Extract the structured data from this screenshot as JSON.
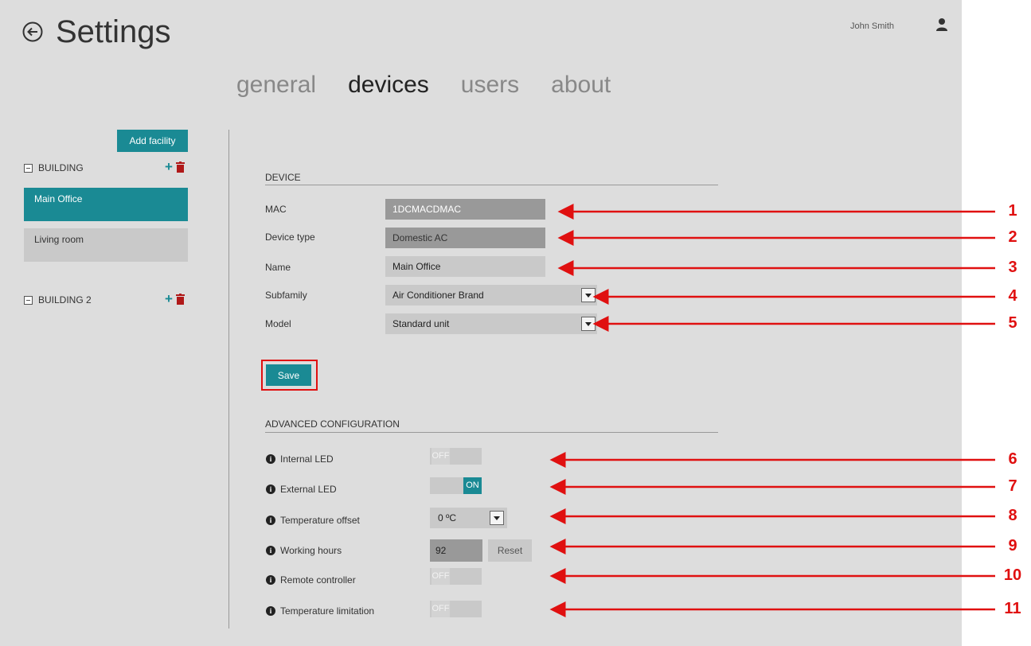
{
  "header": {
    "title": "Settings",
    "user_name": "John Smith"
  },
  "tabs": [
    {
      "label": "general",
      "active": false
    },
    {
      "label": "devices",
      "active": true
    },
    {
      "label": "users",
      "active": false
    },
    {
      "label": "about",
      "active": false
    }
  ],
  "sidebar": {
    "add_facility_label": "Add facility",
    "buildings": [
      {
        "name": "BUILDING",
        "rooms": [
          {
            "name": "Main Office",
            "selected": true
          },
          {
            "name": "Living room",
            "selected": false
          }
        ]
      },
      {
        "name": "BUILDING 2",
        "rooms": []
      }
    ]
  },
  "device": {
    "section_title": "DEVICE",
    "mac_label": "MAC",
    "mac_value": "1DCMACDMAC",
    "type_label": "Device type",
    "type_value": "Domestic AC",
    "name_label": "Name",
    "name_value": "Main Office",
    "subfamily_label": "Subfamily",
    "subfamily_value": "Air Conditioner Brand",
    "model_label": "Model",
    "model_value": "Standard unit",
    "save_label": "Save"
  },
  "advanced": {
    "section_title": "ADVANCED CONFIGURATION",
    "internal_led_label": "Internal LED",
    "internal_led_state": "OFF",
    "external_led_label": "External LED",
    "external_led_state": "ON",
    "temp_offset_label": "Temperature offset",
    "temp_offset_value": "0 ºC",
    "working_hours_label": "Working hours",
    "working_hours_value": "92",
    "reset_label": "Reset",
    "remote_label": "Remote controller",
    "remote_state": "OFF",
    "temp_limit_label": "Temperature limitation",
    "temp_limit_state": "OFF"
  },
  "callouts": [
    "1",
    "2",
    "3",
    "4",
    "5",
    "6",
    "7",
    "8",
    "9",
    "10",
    "11"
  ],
  "colors": {
    "accent": "#1a8a94",
    "annotation": "#e01010",
    "panel_bg": "#dddddd",
    "delete": "#b01818"
  },
  "icons": [
    "back-arrow-icon",
    "user-icon",
    "collapse-icon",
    "plus-icon",
    "trash-icon",
    "info-icon",
    "chevron-down-icon",
    "arrow-icon"
  ]
}
